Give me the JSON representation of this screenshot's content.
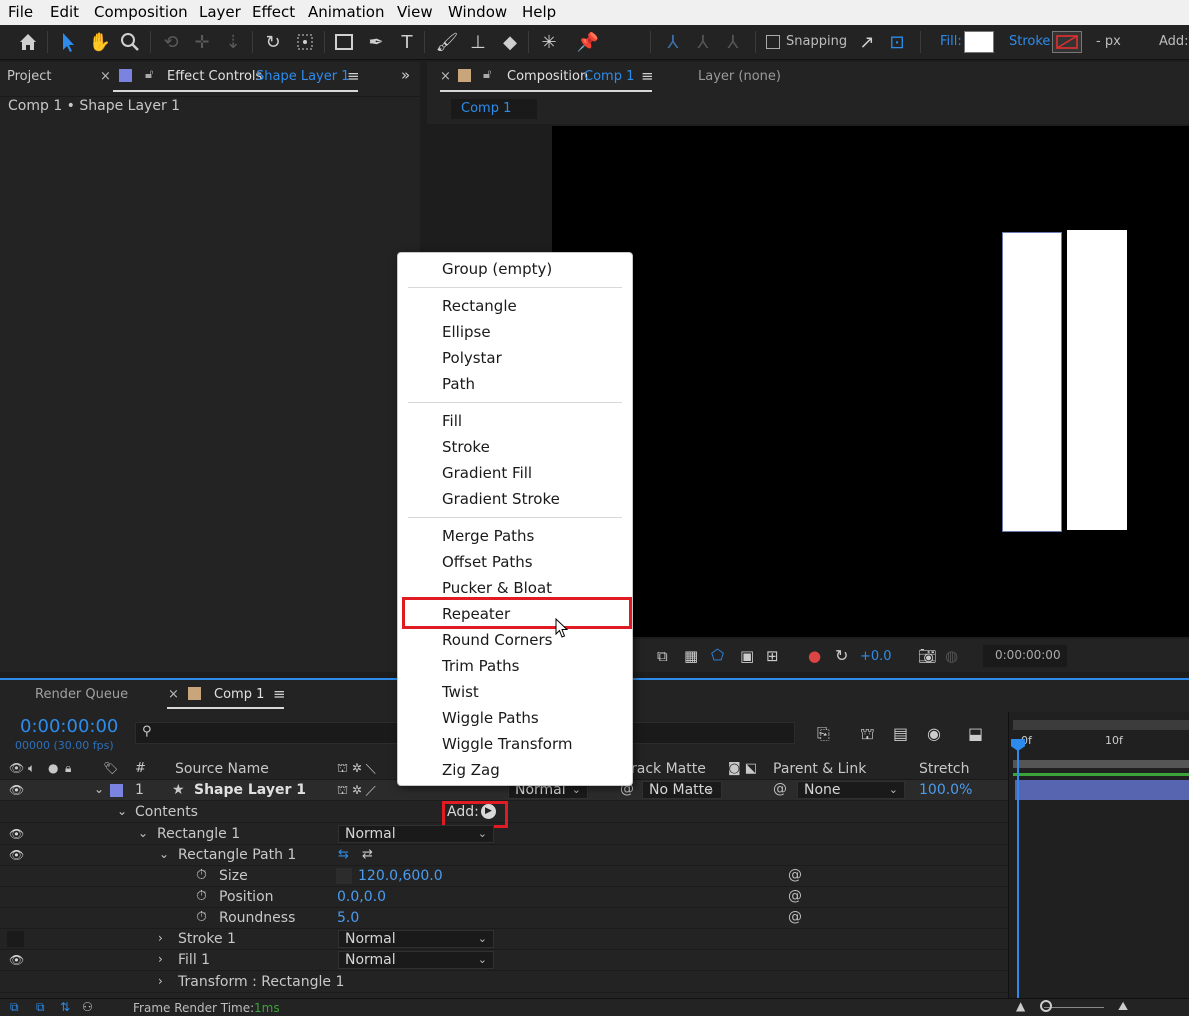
{
  "menubar": [
    "File",
    "Edit",
    "Composition",
    "Layer",
    "Effect",
    "Animation",
    "View",
    "Window",
    "Help"
  ],
  "toolbar": {
    "snapping_label": "Snapping",
    "fill_label": "Fill:",
    "stroke_label": "Stroke:",
    "stroke_width": "- px",
    "add_label": "Add:"
  },
  "left_panel": {
    "tab_project": "Project",
    "tab_close": "×",
    "tab_effect_controls": "Effect Controls",
    "tab_effect_layer": "Shape Layer 1",
    "breadcrumb": "Comp 1 • Shape Layer 1"
  },
  "comp_panel": {
    "tab_close": "×",
    "tab_composition": "Composition",
    "tab_comp_name": "Comp 1",
    "tab_layer": "Layer (none)",
    "comp_button": "Comp 1",
    "exposure_value": "+0.0",
    "timecode": "0:00:00:00"
  },
  "context_menu": {
    "items": [
      [
        "Group (empty)"
      ],
      [
        "Rectangle",
        "Ellipse",
        "Polystar",
        "Path"
      ],
      [
        "Fill",
        "Stroke",
        "Gradient Fill",
        "Gradient Stroke"
      ],
      [
        "Merge Paths",
        "Offset Paths",
        "Pucker & Bloat",
        "Repeater",
        "Round Corners",
        "Trim Paths",
        "Twist",
        "Wiggle Paths",
        "Wiggle Transform",
        "Zig Zag"
      ]
    ],
    "highlighted": "Repeater"
  },
  "timeline": {
    "tab_render_queue": "Render Queue",
    "tab_close": "×",
    "tab_comp": "Comp 1",
    "timecode": "0:00:00:00",
    "frame_info": "00000 (30.00 fps)",
    "search_placeholder": "",
    "headers": {
      "num": "#",
      "source_name": "Source Name",
      "track_matte": "rack Matte",
      "parent_link": "Parent & Link",
      "stretch": "Stretch"
    },
    "ruler": [
      "0f",
      "10f"
    ],
    "layer": {
      "index": "1",
      "name": "Shape Layer 1",
      "mode": "Normal",
      "matte": "No Matte",
      "parent": "None",
      "stretch": "100.0%"
    },
    "contents_label": "Contents",
    "add_label": "Add:",
    "rows": {
      "rectangle": "Rectangle 1",
      "rectangle_mode": "Normal",
      "rect_path": "Rectangle Path 1",
      "size_label": "Size",
      "size_value": "120.0,600.0",
      "position_label": "Position",
      "position_value": "0.0,0.0",
      "roundness_label": "Roundness",
      "roundness_value": "5.0",
      "stroke": "Stroke 1",
      "stroke_mode": "Normal",
      "fill": "Fill 1",
      "fill_mode": "Normal",
      "transform": "Transform : Rectangle 1"
    },
    "footer_label": "Frame Render Time:",
    "footer_value": "1ms"
  },
  "colors": {
    "accent_blue": "#2d8ceb",
    "highlight_red": "#e01b24",
    "layer_swatch": "#7b83e0",
    "comp_swatch": "#c8a57a"
  }
}
